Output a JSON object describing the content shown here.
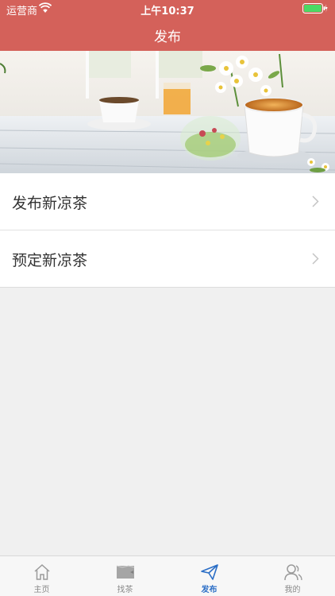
{
  "status_bar": {
    "carrier": "运营商",
    "time": "上午10:37"
  },
  "header": {
    "title": "发布"
  },
  "menu": {
    "items": [
      {
        "label": "发布新凉茶"
      },
      {
        "label": "预定新凉茶"
      }
    ]
  },
  "tabbar": {
    "tabs": [
      {
        "label": "主页",
        "icon": "home-icon"
      },
      {
        "label": "找茶",
        "icon": "map-icon"
      },
      {
        "label": "发布",
        "icon": "send-icon"
      },
      {
        "label": "我的",
        "icon": "user-icon"
      }
    ],
    "active_tab": "发布"
  },
  "colors": {
    "header_bg": "#d4615a",
    "active_tab": "#2b6ec6",
    "inactive_tab": "#8a8a8a",
    "page_bg": "#f0f0f0"
  }
}
